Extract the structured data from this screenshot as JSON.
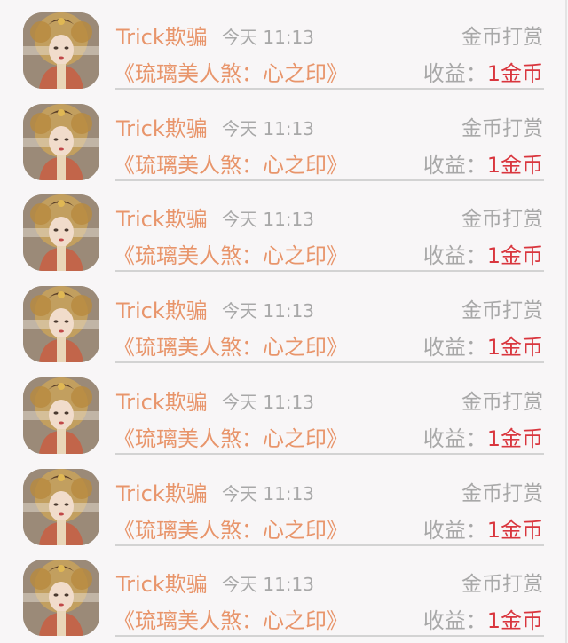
{
  "records": [
    {
      "name": "Trick欺骗",
      "time": "今天 11:13",
      "type": "金币打赏",
      "title": "《琉璃美人煞：心之印》",
      "earning_label": "收益：",
      "earning_value": "1金币"
    },
    {
      "name": "Trick欺骗",
      "time": "今天 11:13",
      "type": "金币打赏",
      "title": "《琉璃美人煞：心之印》",
      "earning_label": "收益：",
      "earning_value": "1金币"
    },
    {
      "name": "Trick欺骗",
      "time": "今天 11:13",
      "type": "金币打赏",
      "title": "《琉璃美人煞：心之印》",
      "earning_label": "收益：",
      "earning_value": "1金币"
    },
    {
      "name": "Trick欺骗",
      "time": "今天 11:13",
      "type": "金币打赏",
      "title": "《琉璃美人煞：心之印》",
      "earning_label": "收益：",
      "earning_value": "1金币"
    },
    {
      "name": "Trick欺骗",
      "time": "今天 11:13",
      "type": "金币打赏",
      "title": "《琉璃美人煞：心之印》",
      "earning_label": "收益：",
      "earning_value": "1金币"
    },
    {
      "name": "Trick欺骗",
      "time": "今天 11:13",
      "type": "金币打赏",
      "title": "《琉璃美人煞：心之印》",
      "earning_label": "收益：",
      "earning_value": "1金币"
    },
    {
      "name": "Trick欺骗",
      "time": "今天 11:13",
      "type": "金币打赏",
      "title": "《琉璃美人煞：心之印》",
      "earning_label": "收益：",
      "earning_value": "1金币"
    }
  ],
  "colors": {
    "accent": "#e8956b",
    "muted": "#a8a8a8",
    "earning": "#d9363e",
    "background": "#f8f6f7"
  }
}
